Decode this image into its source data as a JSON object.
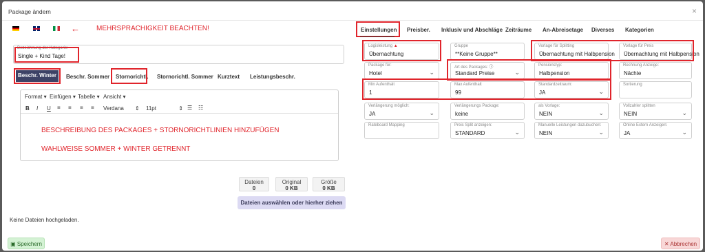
{
  "modal": {
    "title": "Package ändern"
  },
  "annotations": {
    "multilingual": "MEHRSPRACHIGKEIT BEACHTEN!",
    "description_hint": "BESCHREIBUNG DES PACKAGES + STORNORICHTLINIEN HINZUFÜGEN",
    "season_hint": "WAHLWEISE SOMMER + WINTER GETRENNT",
    "arrow": "←"
  },
  "category": {
    "label": "Bezeichnung der Kategorie:",
    "value": "Single + Kind Tage!"
  },
  "desc_tabs": [
    "Beschr. Winter",
    "Beschr. Sommer",
    "Stornorichtl.",
    "Stornorichtl. Sommer",
    "Kurztext",
    "Leistungsbeschr."
  ],
  "editor": {
    "menu": [
      "Format",
      "Einfügen",
      "Tabelle",
      "Ansicht"
    ],
    "font": "Verdana",
    "size": "11pt",
    "b": "B",
    "i": "I",
    "u": "U"
  },
  "files": {
    "stats": [
      {
        "label": "Dateien",
        "value": "0"
      },
      {
        "label": "Original",
        "value": "0 KB"
      },
      {
        "label": "Größe",
        "value": "0 KB"
      }
    ],
    "upload_label": "Dateien auswählen oder hierher ziehen",
    "empty_text": "Keine Dateien hochgeladen."
  },
  "right_tabs": [
    "Einstellungen",
    "Preisber.",
    "Inklusiv und Abschläge",
    "Zeiträume",
    "An-Abreisetage",
    "Diverses",
    "Kategorien"
  ],
  "fields": {
    "logisleistung": {
      "label": "Logisleistung",
      "value": "Übernachtung"
    },
    "gruppe": {
      "label": "Gruppe",
      "value": "**Keine Gruppe**"
    },
    "vorlage_splitting": {
      "label": "Vorlage für Splitting",
      "value": "Übernachtung mit Halbpension"
    },
    "vorlage_preis": {
      "label": "Vorlage für Preis",
      "value": "Übernachtung mit Halbpension"
    },
    "package_fuer": {
      "label": "Package für:",
      "value": "Hotel"
    },
    "art_package": {
      "label": "Art des Packages:",
      "value": "Standard Preise"
    },
    "pensionstyp": {
      "label": "Pensionstyp:",
      "value": "Halbpension"
    },
    "rechnung": {
      "label": "Rechnung Anzeige:",
      "value": "Nächte"
    },
    "min_aufenthalt": {
      "label": "Min Aufenthalt",
      "value": "1"
    },
    "max_aufenthalt": {
      "label": "Max Aufenthalt",
      "value": "99"
    },
    "standardzeitraum": {
      "label": "Standardzeitraum:",
      "value": "JA"
    },
    "sortierung": {
      "label": "Sortierung",
      "value": ""
    },
    "verlaengerung": {
      "label": "Verlängerung möglich:",
      "value": "JA"
    },
    "verlaengerung_package": {
      "label": "Verlängerungs Package:",
      "value": "keine"
    },
    "als_vorlage": {
      "label": "als Vorlage:",
      "value": "NEIN"
    },
    "vollzahler": {
      "label": "Vollzahler splitten",
      "value": "NEIN"
    },
    "rateboard": {
      "label": "Rateboard Mapping",
      "value": ""
    },
    "preis_split": {
      "label": "Preis Split anzeigen:",
      "value": "STANDARD"
    },
    "manuelle": {
      "label": "Manuelle Leistungen dazubuchen:",
      "value": "NEIN"
    },
    "online_extern": {
      "label": "Online Extern Anzeigen:",
      "value": "JA"
    }
  },
  "buttons": {
    "save": "Speichern",
    "cancel": "Abbrechen"
  },
  "colors": {
    "annotation_red": "#e0242b",
    "active_tab": "#3d4266",
    "upload_bg": "#dcdaf3"
  }
}
